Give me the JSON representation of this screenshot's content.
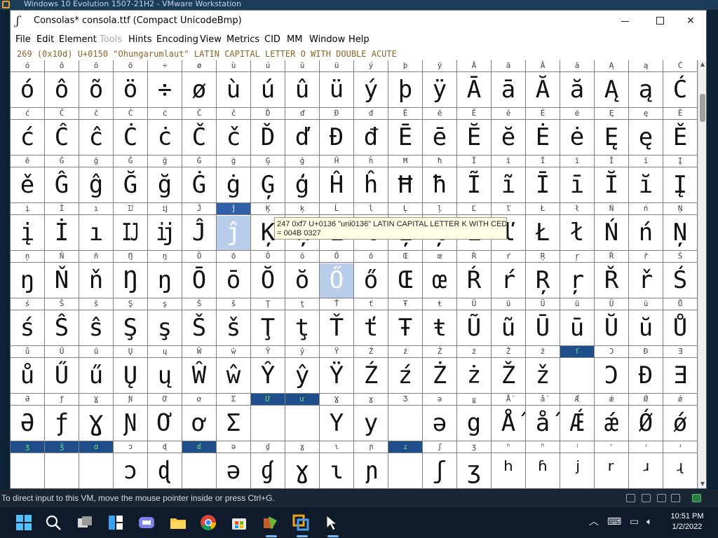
{
  "vm": {
    "window_title": "Windows 10 Evolution 1507-21H2 - VMware Workstation",
    "status_message": "To direct input to this VM, move the mouse pointer inside or press Ctrl+G."
  },
  "fontforge": {
    "title": "Consolas*  consola.ttf (Compact UnicodeBmp)",
    "menu": [
      "File",
      "Edit",
      "Element",
      "Tools",
      "Hints",
      "Encoding",
      "View",
      "Metrics",
      "CID",
      "MM",
      "Window",
      "Help"
    ],
    "disabled_menu": [
      "Tools"
    ],
    "info_line": "269 (0x10d) U+0150 \"Ohungarumlaut\" LATIN CAPITAL LETTER O WITH DOUBLE ACUTE",
    "tooltip": {
      "line1": "247 0xf7 U+0136 \"uni0136\" LATIN CAPITAL LETTER K WITH CEDILLA",
      "line2": "= 004B 0327"
    },
    "grid_rows": [
      [
        "ó",
        "ô",
        "õ",
        "ö",
        "÷",
        "ø",
        "ù",
        "ú",
        "û",
        "ü",
        "ý",
        "þ",
        "ÿ",
        "Ā",
        "ā",
        "Ă",
        "ă",
        "Ą",
        "ą",
        "Ć"
      ],
      [
        "ć",
        "Ĉ",
        "ĉ",
        "Ċ",
        "ċ",
        "Č",
        "č",
        "Ď",
        "ď",
        "Đ",
        "đ",
        "Ē",
        "ē",
        "Ĕ",
        "ĕ",
        "Ė",
        "ė",
        "Ę",
        "ę",
        "Ě"
      ],
      [
        "ě",
        "Ĝ",
        "ĝ",
        "Ğ",
        "ğ",
        "Ġ",
        "ġ",
        "Ģ",
        "ģ",
        "Ĥ",
        "ĥ",
        "Ħ",
        "ħ",
        "Ĩ",
        "ĩ",
        "Ī",
        "ī",
        "Ĭ",
        "ĭ",
        "Į"
      ],
      [
        "į",
        "İ",
        "ı",
        "Ĳ",
        "ĳ",
        "Ĵ",
        "ĵ",
        "Ķ",
        "ķ",
        "Ĺ",
        "ĺ",
        "Ļ",
        "ļ",
        "Ľ",
        "ľ",
        "Ł",
        "ł",
        "Ń",
        "ń",
        "Ņ"
      ],
      [
        "ņ",
        "Ň",
        "ň",
        "Ŋ",
        "ŋ",
        "Ō",
        "ō",
        "Ŏ",
        "ŏ",
        "Ő",
        "ő",
        "Œ",
        "œ",
        "Ŕ",
        "ŕ",
        "Ŗ",
        "ŗ",
        "Ř",
        "ř",
        "Ś"
      ],
      [
        "ś",
        "Ŝ",
        "ŝ",
        "Ş",
        "ş",
        "Š",
        "š",
        "Ţ",
        "ţ",
        "Ť",
        "ť",
        "Ŧ",
        "ŧ",
        "Ũ",
        "ũ",
        "Ū",
        "ū",
        "Ŭ",
        "ŭ",
        "Ů"
      ],
      [
        "ů",
        "Ű",
        "ű",
        "Ų",
        "ų",
        "Ŵ",
        "ŵ",
        "Ŷ",
        "ŷ",
        "Ÿ",
        "Ź",
        "ź",
        "Ż",
        "ż",
        "Ž",
        "ž",
        "ſ",
        "Ɔ",
        "Đ",
        "Ǝ"
      ],
      [
        "Ə",
        "ƒ",
        "Ɣ",
        "Ɲ",
        "Ơ",
        "ơ",
        "Ʃ",
        "Ư",
        "ư",
        "Ɣ",
        "ɣ",
        "Ʒ",
        "ǝ",
        "ǥ",
        "Ǻ",
        "ǻ",
        "Ǽ",
        "ǽ",
        "Ǿ",
        "ǿ"
      ],
      [
        "ʒ",
        "ǯ",
        "ɑ",
        "ɔ",
        "ɖ",
        "ɗ",
        "ə",
        "ɠ",
        "ɣ",
        "ɩ",
        "ɲ",
        "ɾ",
        "ʃ",
        "ʒ",
        "ʰ",
        "ʱ",
        "ʲ",
        "ʳ",
        "ʴ",
        "ʵ"
      ]
    ],
    "grid_big": [
      [
        "ó",
        "ô",
        "õ",
        "ö",
        "÷",
        "ø",
        "ù",
        "ú",
        "û",
        "ü",
        "ý",
        "þ",
        "ÿ",
        "Ā",
        "ā",
        "Ă",
        "ă",
        "Ą",
        "ą",
        "Ć"
      ],
      [
        "ć",
        "Ĉ",
        "ĉ",
        "Ċ",
        "ċ",
        "Č",
        "č",
        "Ď",
        "ď",
        "Đ",
        "đ",
        "Ē",
        "ē",
        "Ĕ",
        "ĕ",
        "Ė",
        "ė",
        "Ę",
        "ę",
        "Ě"
      ],
      [
        "ě",
        "Ĝ",
        "ĝ",
        "Ğ",
        "ğ",
        "Ġ",
        "ġ",
        "Ģ",
        "ģ",
        "Ĥ",
        "ĥ",
        "Ħ",
        "ħ",
        "Ĩ",
        "ĩ",
        "Ī",
        "ī",
        "Ĭ",
        "ĭ",
        "Į"
      ],
      [
        "į",
        "İ",
        "ı",
        "Ĳ",
        "ĳ",
        "Ĵ",
        "ĵ",
        "Ķ",
        "ķ",
        "Ĺ",
        "ĺ",
        "Ļ",
        "ļ",
        "Ľ",
        "ľ",
        "Ł",
        "ł",
        "Ń",
        "ń",
        "Ņ"
      ],
      [
        "ŋ",
        "Ň",
        "ň",
        "Ŋ",
        "ŋ",
        "Ō",
        "ō",
        "Ŏ",
        "ŏ",
        "Ő",
        "ő",
        "Œ",
        "œ",
        "Ŕ",
        "ŕ",
        "Ŗ",
        "ŗ",
        "Ř",
        "ř",
        "Ś"
      ],
      [
        "ś",
        "Ŝ",
        "ŝ",
        "Ş",
        "ş",
        "Š",
        "š",
        "Ţ",
        "ţ",
        "Ť",
        "ť",
        "Ŧ",
        "ŧ",
        "Ũ",
        "ũ",
        "Ū",
        "ū",
        "Ŭ",
        "ŭ",
        "Ů"
      ],
      [
        "ů",
        "Ű",
        "ű",
        "Ų",
        "ų",
        "Ŵ",
        "ŵ",
        "Ŷ",
        "ŷ",
        "Ÿ",
        "Ź",
        "ź",
        "Ż",
        "ż",
        "Ž",
        "ž",
        "",
        "Ɔ",
        "Đ",
        "Ǝ"
      ],
      [
        "Ə",
        "ƒ",
        "Ɣ",
        "Ɲ",
        "Ơ",
        "ơ",
        "Ʃ",
        "",
        "",
        "Y",
        "y",
        "",
        "ə",
        "g",
        "Ǻ",
        "ǻ",
        "Ǽ",
        "ǽ",
        "Ǿ",
        "ǿ"
      ],
      [
        "",
        "",
        "",
        "ɔ",
        "ɖ",
        "",
        "ə",
        "ɠ",
        "ɣ",
        "ɩ",
        "ɲ",
        "",
        "ʃ",
        "ʒ",
        "ʰ",
        "ʱ",
        "ʲ",
        "ʳ",
        "ʴ",
        "ʵ"
      ]
    ],
    "marked_headers": [
      [
        6,
        16
      ],
      [
        7,
        7
      ],
      [
        7,
        8
      ],
      [
        8,
        0
      ],
      [
        8,
        1
      ],
      [
        8,
        2
      ],
      [
        8,
        5
      ],
      [
        8,
        11
      ]
    ],
    "selected_cells": [
      [
        3,
        6
      ],
      [
        4,
        9
      ]
    ]
  },
  "taskbar": {
    "time": "10:51 PM",
    "date": "1/2/2022",
    "icons": [
      "start-icon",
      "search-icon",
      "task-view-icon",
      "widgets-icon",
      "chat-icon",
      "file-explorer-icon",
      "chrome-icon",
      "store-icon",
      "fontforge-icon",
      "vmware-icon",
      "cursor-app-icon"
    ]
  },
  "colors": {
    "marked_header_bg": "#1f4e8a",
    "selection": "#b7cde9",
    "info_text": "#8a6424"
  }
}
